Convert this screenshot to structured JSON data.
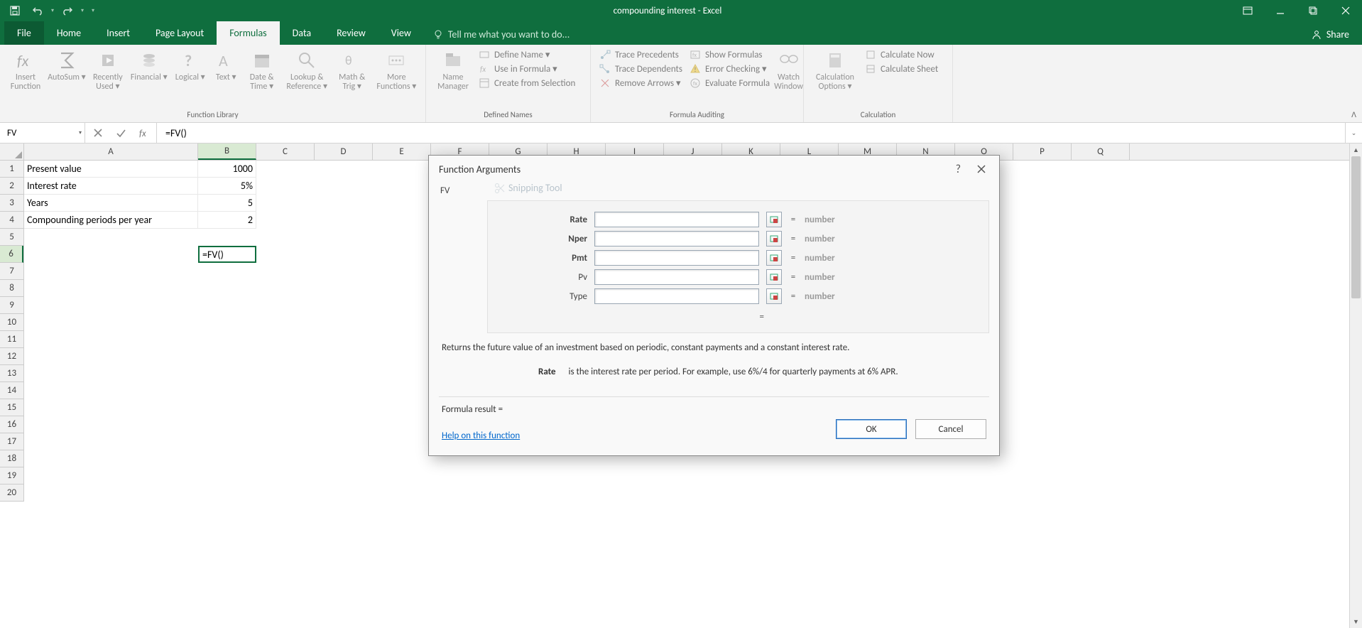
{
  "title": "compounding interest - Excel",
  "tabs": {
    "file": "File",
    "home": "Home",
    "insert": "Insert",
    "pagelayout": "Page Layout",
    "formulas": "Formulas",
    "data": "Data",
    "review": "Review",
    "view": "View",
    "tellme": "Tell me what you want to do...",
    "share": "Share"
  },
  "ribbon": {
    "group_flib": "Function Library",
    "group_dn": "Defined Names",
    "group_fa": "Formula Auditing",
    "group_calc": "Calculation",
    "insertfn": "Insert Function",
    "autosum": "AutoSum",
    "recent": "Recently Used",
    "financial": "Financial",
    "logical": "Logical",
    "text": "Text",
    "datetime": "Date & Time",
    "lookup": "Lookup & Reference",
    "math": "Math & Trig",
    "more": "More Functions",
    "namemgr": "Name Manager",
    "defname": "Define Name",
    "useinf": "Use in Formula",
    "createfs": "Create from Selection",
    "traceprec": "Trace Precedents",
    "tracedep": "Trace Dependents",
    "removearr": "Remove Arrows",
    "showform": "Show Formulas",
    "errcheck": "Error Checking",
    "evalform": "Evaluate Formula",
    "watchwin": "Watch Window",
    "calcopt": "Calculation Options",
    "calcnow": "Calculate Now",
    "calcsheet": "Calculate Sheet"
  },
  "namebox": "FV",
  "formula": "=FV()",
  "columns": [
    "A",
    "B",
    "C",
    "D",
    "E",
    "P",
    "Q"
  ],
  "colwidths": {
    "A": 245,
    "B": 82,
    "C": 82,
    "D": 82,
    "E": 82,
    "P": 82,
    "Q": 82
  },
  "rows": [
    1,
    2,
    3,
    4,
    5,
    6,
    7,
    8,
    9,
    10,
    11,
    12,
    13,
    14,
    15,
    16,
    17,
    18,
    19,
    20
  ],
  "data": {
    "A1": "Present value",
    "B1": "1000",
    "A2": "Interest rate",
    "B2": "5%",
    "A3": "Years",
    "B3": "5",
    "A4": "Compounding periods per year",
    "B4": "2",
    "B6": "=FV()"
  },
  "active": {
    "row": 6,
    "col": "B"
  },
  "dialog": {
    "title": "Function Arguments",
    "fn": "FV",
    "args": [
      {
        "name": "Rate",
        "bold": true,
        "result": "number"
      },
      {
        "name": "Nper",
        "bold": true,
        "result": "number"
      },
      {
        "name": "Pmt",
        "bold": true,
        "result": "number"
      },
      {
        "name": "Pv",
        "bold": false,
        "result": "number"
      },
      {
        "name": "Type",
        "bold": false,
        "result": "number"
      }
    ],
    "eq": "=",
    "desc": "Returns the future value of an investment based on periodic, constant payments and a constant interest rate.",
    "argname": "Rate",
    "argdesc": "is the interest rate per period. For example, use 6%/4 for quarterly payments at 6% APR.",
    "formres": "Formula result =",
    "help": "Help on this function",
    "ok": "OK",
    "cancel": "Cancel"
  },
  "snipghost": "Snipping Tool"
}
